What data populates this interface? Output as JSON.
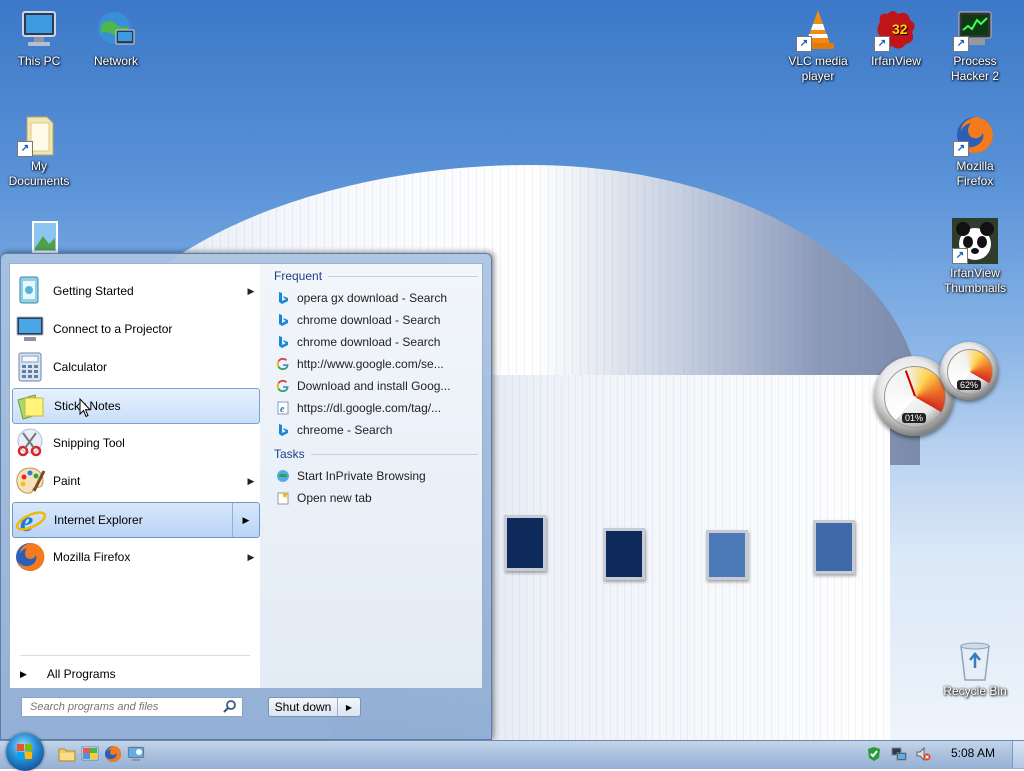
{
  "desktop": {
    "icons_left": [
      {
        "name": "This PC"
      },
      {
        "name": "Network"
      },
      {
        "name": "My Documents",
        "line1": "My",
        "line2": "Documents"
      }
    ],
    "icons_right": [
      {
        "name": "VLC media player",
        "line1": "VLC media",
        "line2": "player"
      },
      {
        "name": "IrfanView"
      },
      {
        "name": "Process Hacker 2",
        "line1": "Process",
        "line2": "Hacker 2"
      },
      {
        "name": "Mozilla Firefox",
        "line1": "Mozilla",
        "line2": "Firefox"
      },
      {
        "name": "IrfanView Thumbnails",
        "line1": "IrfanView",
        "line2": "Thumbnails"
      },
      {
        "name": "Recycle Bin"
      }
    ],
    "irfanview_badge": "32",
    "gadget": {
      "cpu_percent": "01%",
      "mem_percent": "62%"
    }
  },
  "start_menu": {
    "programs": [
      {
        "label": "Getting Started",
        "has_submenu": true
      },
      {
        "label": "Connect to a Projector",
        "has_submenu": false
      },
      {
        "label": "Calculator",
        "has_submenu": false
      },
      {
        "label": "Sticky Notes",
        "has_submenu": false
      },
      {
        "label": "Snipping Tool",
        "has_submenu": false
      },
      {
        "label": "Paint",
        "has_submenu": true
      },
      {
        "label": "Internet Explorer",
        "has_submenu": true
      },
      {
        "label": "Mozilla Firefox",
        "has_submenu": true
      }
    ],
    "all_programs": "All Programs",
    "jump_list": {
      "frequent_header": "Frequent",
      "frequent": [
        {
          "icon": "bing",
          "text": "opera gx download - Search"
        },
        {
          "icon": "bing",
          "text": "chrome download - Search"
        },
        {
          "icon": "bing",
          "text": "chrome download - Search"
        },
        {
          "icon": "google",
          "text": "http://www.google.com/se..."
        },
        {
          "icon": "google",
          "text": "Download and install Goog..."
        },
        {
          "icon": "ie-page",
          "text": "https://dl.google.com/tag/..."
        },
        {
          "icon": "bing",
          "text": "chreome - Search"
        }
      ],
      "tasks_header": "Tasks",
      "tasks": [
        {
          "icon": "inprivate",
          "text": "Start InPrivate Browsing"
        },
        {
          "icon": "new-tab",
          "text": "Open new tab"
        }
      ]
    },
    "search_placeholder": "Search programs and files",
    "shutdown_label": "Shut down"
  },
  "taskbar": {
    "pinned": [
      "Windows Explorer",
      "Control Panel",
      "Mozilla Firefox",
      "Remote Desktop"
    ],
    "clock": "5:08 AM"
  }
}
